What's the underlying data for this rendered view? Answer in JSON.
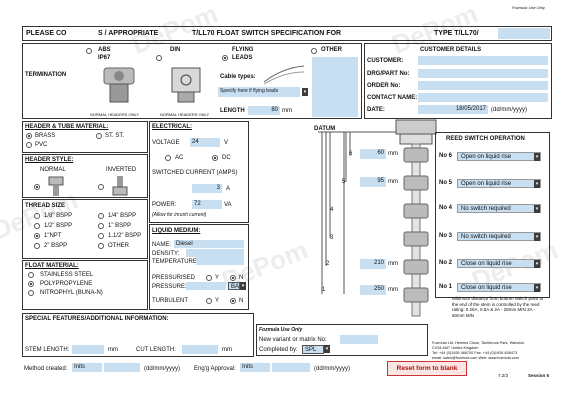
{
  "top_note": "Fozmula Use Only",
  "header": {
    "please": "PLEASE CO",
    "appropriate": "S / APPROPRIATE",
    "title": "T/LL70 FLOAT SWITCH SPECIFICATION FOR",
    "type": "TYPE T/LL70/"
  },
  "termination": {
    "label": "TERMINATION",
    "abs": "ABS",
    "ip67": "IP67",
    "din": "DIN",
    "flying": "FLYING",
    "leads": "LEADS",
    "other": "OTHER",
    "normal_headers_1": "NORMAL HEADERS ONLY",
    "normal_headers_2": "NORMAL HEADERS ONLY",
    "cable_types": "Cable types:",
    "specify": "Specify here if flying leads",
    "length_label": "LENGTH",
    "length_value": "80",
    "length_unit": "mm"
  },
  "customer": {
    "title": "CUSTOMER DETAILS",
    "customer": "CUSTOMER:",
    "drg": "DRG/PART No:",
    "order": "ORDER No:",
    "contact": "CONTACT NAME:",
    "date": "DATE:",
    "date_value": "18/05/2017",
    "date_fmt": "(dd/mm/yyyy)"
  },
  "material": {
    "title": "HEADER & TUBE MATERIAL:",
    "brass": "BRASS",
    "stst": "ST. ST.",
    "pvc": "PVC"
  },
  "style": {
    "title": "HEADER STYLE:",
    "normal": "NORMAL",
    "inverted": "INVERTED"
  },
  "thread": {
    "title": "THREAD SIZE",
    "opts": [
      "1/8\" BSPP",
      "1/4\" BSPP",
      "1/2\" BSPP",
      "1\" BSPP",
      "1\"NPT",
      "1.1/2\" BSPP",
      "2\" BSPP",
      "OTHER"
    ]
  },
  "float": {
    "title": "FLOAT MATERIAL:",
    "opts": [
      "STAINLESS STEEL",
      "POLYPROPYLENE",
      "NITROPHYL (BUNA-N)"
    ]
  },
  "electrical": {
    "title": "ELECTRICAL:",
    "voltage": "VOLTAGE",
    "voltage_value": "24",
    "voltage_unit": "V",
    "ac": "AC",
    "dc": "DC",
    "switched": "SWITCHED CURRENT (AMPS)",
    "current_value": "3",
    "current_unit": "A",
    "power": "POWER:",
    "power_value": "72",
    "power_unit": "VA",
    "inrush": "(Allow for inrush current)"
  },
  "liquid": {
    "title": "LIQUID MEDIUM:",
    "name": "NAME:",
    "name_value": "Diesel",
    "density": "DENSITY:",
    "temperature": "TEMPERATURE:",
    "pressurised": "PRESSURISED",
    "y": "Y",
    "n": "N",
    "pressure": "PRESSURE:",
    "bar": "BAR",
    "turbulent": "TURBULENT"
  },
  "datum": {
    "label": "DATUM",
    "rows": [
      {
        "num": "6",
        "value": "60",
        "unit": "mm"
      },
      {
        "num": "5",
        "value": "95",
        "unit": "mm"
      },
      {
        "num": "4",
        "value": "",
        "unit": ""
      },
      {
        "num": "3",
        "value": "",
        "unit": ""
      },
      {
        "num": "2",
        "value": "210",
        "unit": "mm"
      },
      {
        "num": "1",
        "value": "250",
        "unit": "mm"
      }
    ]
  },
  "reed": {
    "title": "REED SWITCH OPERATION",
    "rows": [
      {
        "label": "No 6",
        "value": "Open on liquid rise"
      },
      {
        "label": "No 5",
        "value": "Open on liquid rise"
      },
      {
        "label": "No 4",
        "value": "No switch required"
      },
      {
        "label": "No 3",
        "value": "No switch required"
      },
      {
        "label": "No 2",
        "value": "Close on liquid rise"
      },
      {
        "label": "No 1",
        "value": "Close on liquid rise"
      }
    ]
  },
  "note": "Minimum distance from bottom switch point to the end of the stem is controlled by the reed rating: 0.25A, 0.5A & 2A - 28mm MIN 3A - 60mm MIN",
  "special": {
    "title": "SPECIAL FEATURES/ADDITIONAL INFORMATION:",
    "stem": "STEM LENGTH:",
    "mm1": "mm",
    "cut": "CUT LENGTH:",
    "mm2": "mm"
  },
  "fozmula": {
    "title": "Fozmula Use Only",
    "variant": "New variant or matrix No:",
    "completed": "Completed by:",
    "spl": "SPL"
  },
  "address": {
    "line1": "Fozmula Ltd, Hermes Close, Tachbrook Park, Warwick,",
    "line2": "CV34 6UF, United Kingdom",
    "line3": "Tel: +44 (0)1926 466700  Fax: +44 (0)1926 458473",
    "line4": "email: sales@fozmula.com  Web: www.fozmula.com"
  },
  "footer": {
    "method": "Method created:",
    "inits1": "Inits",
    "fmt1": "(dd/mm/yyyy)",
    "approval": "Eng'g Approval:",
    "inits2": "Inits",
    "fmt2": "(dd/mm/yyyy)",
    "reset": "Reset form to blank",
    "version": "7.2/3",
    "session": "Session 5"
  },
  "watermark": "DePom"
}
